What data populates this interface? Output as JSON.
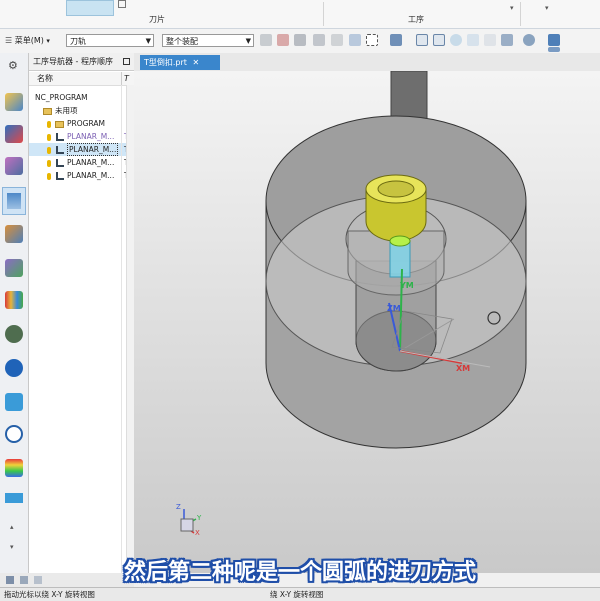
{
  "ribbon": {
    "group_tool": "刀片",
    "group_operation": "工序"
  },
  "toolbar": {
    "menu_label": "菜单(M)",
    "filter_value": "刀轨",
    "scope_value": "整个装配"
  },
  "navigator": {
    "title": "工序导航器 - 程序顺序",
    "col_name": "名称",
    "col_extra": "T",
    "rows": [
      {
        "label": "NC_PROGRAM",
        "extra": ""
      },
      {
        "label": "未用项",
        "extra": ""
      },
      {
        "label": "PROGRAM",
        "extra": ""
      },
      {
        "label": "PLANAR_M...",
        "extra": "T"
      },
      {
        "label": "PLANAR_M...",
        "extra": "T"
      },
      {
        "label": "PLANAR_M...",
        "extra": "T"
      },
      {
        "label": "PLANAR_M...",
        "extra": "T"
      }
    ]
  },
  "viewport": {
    "tab_label": "T型倒扣.prt",
    "axis_y": "YM",
    "axis_z": "ZM",
    "axis_x": "XM",
    "triad_z": "Z",
    "triad_y": "Y",
    "triad_x": "X"
  },
  "subtitle": "然后第二种呢是一个圆弧的进刀方式",
  "status": {
    "left": "拖动光标以绕 X-Y 旋转视图",
    "right": "绕 X-Y 旋转视图"
  },
  "colors": {
    "tab": "#3a86cc",
    "selection": "#cfe6f7",
    "tool_yellow": "#d9d63a",
    "subtitle_outline": "#1f4ea8"
  }
}
